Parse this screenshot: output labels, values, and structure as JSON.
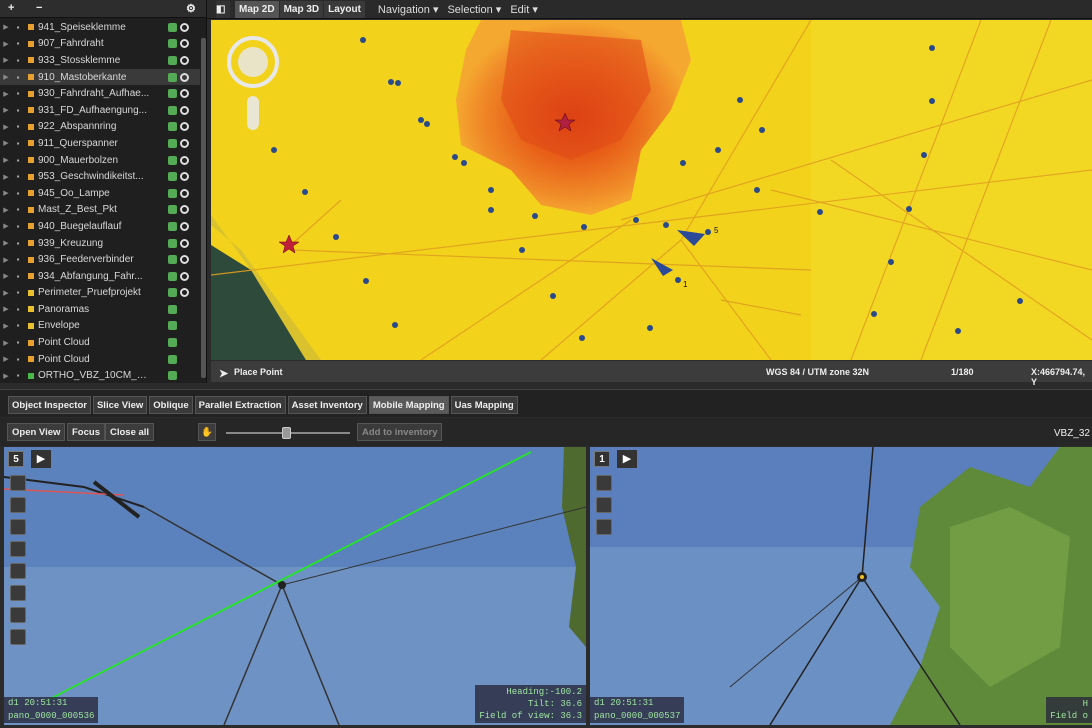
{
  "left_toolbar": {
    "add": "+",
    "remove": "−",
    "settings": "⚙"
  },
  "layers": [
    {
      "label": "941_Speiseklemme",
      "color": "#e8a030"
    },
    {
      "label": "907_Fahrdraht",
      "color": "#e8a030"
    },
    {
      "label": "933_Stossklemme",
      "color": "#e8a030"
    },
    {
      "label": "910_Mastoberkante",
      "color": "#e8a030"
    },
    {
      "label": "930_Fahrdraht_Aufhae...",
      "color": "#e8a030"
    },
    {
      "label": "931_FD_Aufhaengung...",
      "color": "#e8a030"
    },
    {
      "label": "922_Abspannring",
      "color": "#e8a030"
    },
    {
      "label": "911_Querspanner",
      "color": "#e8a030"
    },
    {
      "label": "900_Mauerbolzen",
      "color": "#e8a030"
    },
    {
      "label": "953_Geschwindikeitst...",
      "color": "#e8a030"
    },
    {
      "label": "945_Oo_Lampe",
      "color": "#e8a030"
    },
    {
      "label": "Mast_Z_Best_Pkt",
      "color": "#e8a030"
    },
    {
      "label": "940_Buegelauflauf",
      "color": "#e8a030"
    },
    {
      "label": "939_Kreuzung",
      "color": "#e8a030"
    },
    {
      "label": "936_Feederverbinder",
      "color": "#e8a030"
    },
    {
      "label": "934_Abfangung_Fahr...",
      "color": "#e8a030"
    },
    {
      "label": "Perimeter_Pruefprojekt",
      "color": "#e8c030"
    },
    {
      "label": "Panoramas",
      "color": "#e8c030"
    },
    {
      "label": "Envelope",
      "color": "#e8c030"
    },
    {
      "label": "Point Cloud",
      "color": "#e8a030"
    },
    {
      "label": "Point Cloud",
      "color": "#e8a030"
    },
    {
      "label": "ORTHO_VBZ_10CM_c...",
      "color": "#4ab84a"
    }
  ],
  "map_tabs": [
    "Map 2D",
    "Map 3D",
    "Layout"
  ],
  "map_menus": [
    "Navigation ▾",
    "Selection ▾",
    "Edit ▾"
  ],
  "map_status": {
    "tool": "Place Point",
    "crs": "WGS 84 / UTM zone 32N",
    "scale": "1/180",
    "coords": "X:466794.74, Y"
  },
  "map_labels": {
    "p5": "5",
    "p1": "1"
  },
  "bottom_tabs": [
    "Object Inspector",
    "Slice View",
    "Oblique",
    "Parallel Extraction",
    "Asset Inventory",
    "Mobile Mapping",
    "Uas Mapping"
  ],
  "bottom_buttons": {
    "open_view": "Open View",
    "focus": "Focus",
    "close_all": "Close all",
    "add_inventory": "Add to inventory"
  },
  "slider_level": 0.48,
  "vbz_label": "VBZ_32",
  "view1": {
    "number": "5",
    "time": "d1 20:51:31",
    "pano": "pano_0000_000536",
    "heading": "Heading:-100.2",
    "tilt": "Tilt:  36.6",
    "fov": "Field of view:  36.3"
  },
  "view2": {
    "number": "1",
    "time": "d1 20:51:31",
    "pano": "pano_0000_000537",
    "heading": "H",
    "fov": "Field o"
  }
}
